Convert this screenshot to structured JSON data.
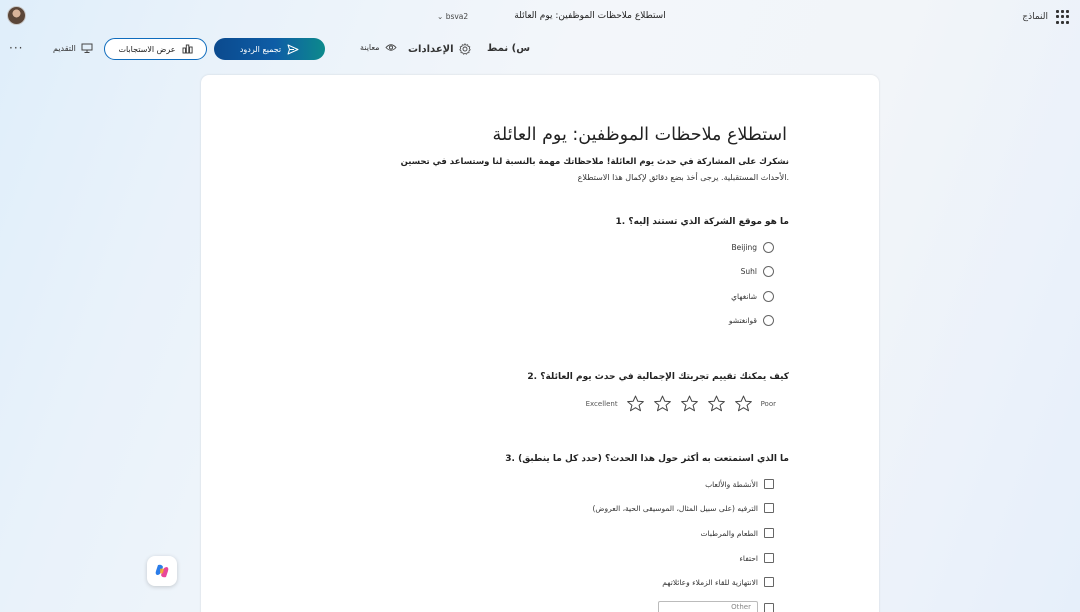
{
  "titlebar": {
    "doc_title": "استطلاع ملاحظات الموظفين: يوم العائلة",
    "version": "bsva2",
    "app_name": "النماذج"
  },
  "toolbar": {
    "present_label": "التقديم",
    "view_responses_label": "عرض الاستجابات",
    "collect_responses_label": "تجميع الردود",
    "preview_label": "معاينة",
    "settings_label": "الإعدادات",
    "style_label": "س) نمط",
    "more_label": "···"
  },
  "form": {
    "title": "استطلاع ملاحظات الموظفين: يوم العائلة",
    "description_line1": "نشكرك على المشاركة في حدث يوم العائلة! ملاحظاتك مهمة بالنسبة لنا وستساعد في تحسين",
    "description_line2": "الأحداث المستقبلية. يرجى أخذ بضع دقائق لإكمال هذا الاستطلاع."
  },
  "questions": [
    {
      "title": "1. ما هو موقع الشركة الذي تستند إليه؟",
      "type": "radio",
      "options": [
        "Beijing",
        "Suhl",
        "شانغهاي",
        "قوانغتشو"
      ]
    },
    {
      "title": "2. كيف يمكنك تقييم تجربتك الإجمالية في حدث يوم العائلة؟",
      "type": "rating",
      "low_label": "Poor",
      "high_label": "Excellent",
      "stars": 5
    },
    {
      "title": "3. ما الذي استمتعت به أكثر حول هذا الحدث؟ (حدد كل ما ينطبق)",
      "type": "checkbox",
      "options": [
        "الأنشطة والألعاب",
        "الترفيه (على سبيل المثال، الموسيقى الحية، العروض)",
        "الطعام والمرطبات",
        "احتفاء",
        "الانتهازية للقاء الزملاء وعائلاتهم"
      ],
      "other_placeholder": "Other"
    }
  ],
  "colors": {
    "accent": "#0f6cbd",
    "collect_gradient_start": "#0b4a8e",
    "collect_gradient_end": "#0d8a8c"
  },
  "icons": [
    "waffle-icon",
    "present-icon",
    "chart-icon",
    "send-icon",
    "eye-icon",
    "gear-icon",
    "chevron-down-icon",
    "star-icon",
    "copilot-icon"
  ]
}
